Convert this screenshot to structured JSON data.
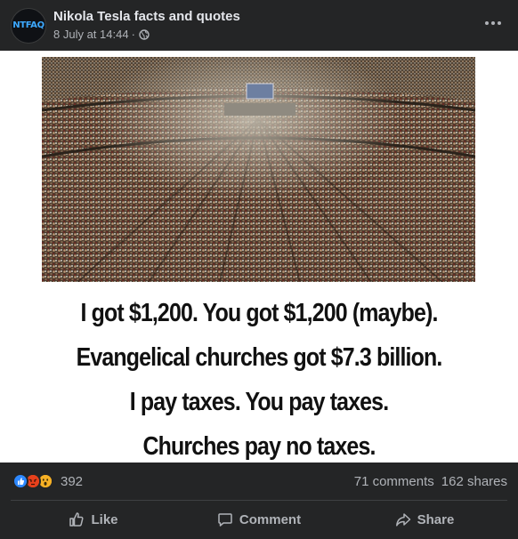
{
  "post": {
    "page_name": "Nikola Tesla facts and quotes",
    "avatar_text": "NTFAQ",
    "date": "8 July at 14:44",
    "separator": "·",
    "privacy_icon": "globe-icon",
    "more_icon": "more-options-icon"
  },
  "image": {
    "lines": [
      "I got $1,200. You got $1,200 (maybe).",
      "Evangelical churches got ",
      "$7.3 billion.",
      "I pay taxes. You pay taxes.",
      "Churches pay no taxes."
    ]
  },
  "stats": {
    "reactions": [
      "like-reaction-icon",
      "angry-reaction-icon",
      "wow-reaction-icon"
    ],
    "reaction_count": "392",
    "comments": "71 comments",
    "shares": "162 shares"
  },
  "actions": {
    "like": "Like",
    "comment": "Comment",
    "share": "Share"
  },
  "colors": {
    "background": "#242526",
    "text_primary": "#e4e6eb",
    "text_secondary": "#b0b3b8",
    "like_blue": "#2d88ff",
    "angry_orange": "#e9710f"
  }
}
